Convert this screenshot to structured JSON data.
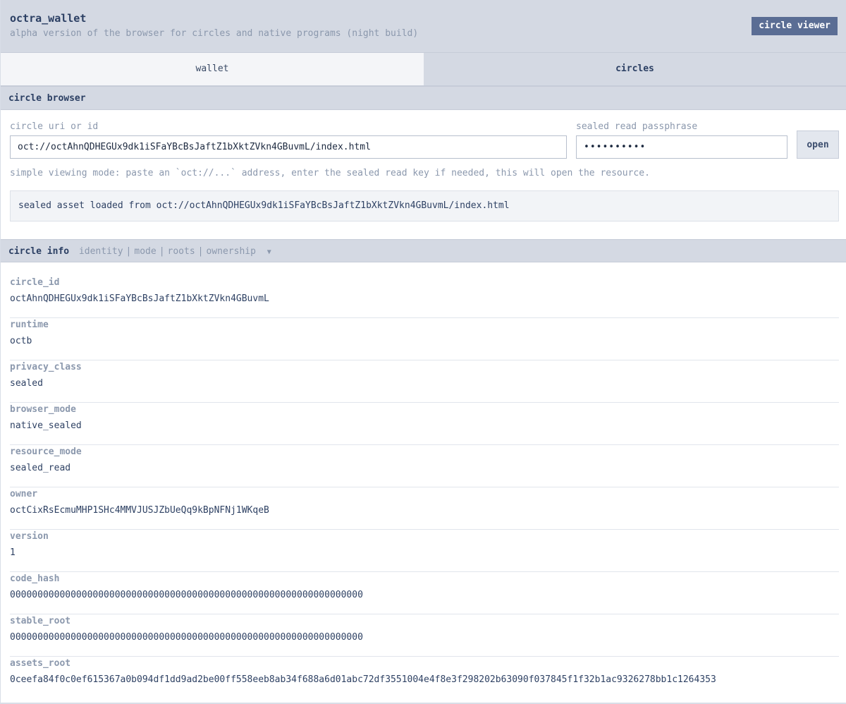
{
  "header": {
    "title": "octra_wallet",
    "subtitle": "alpha version of the browser for circles and native programs (night build)",
    "viewer_button": "circle viewer"
  },
  "tabs": {
    "wallet": "wallet",
    "circles": "circles",
    "active": "circles"
  },
  "browser": {
    "section_title": "circle browser",
    "uri_label": "circle uri or id",
    "uri_value": "oct://octAhnQDHEGUx9dk1iSFaYBcBsJaftZ1bXktZVkn4GBuvmL/index.html",
    "pass_label": "sealed read passphrase",
    "pass_value": "••••••••••",
    "open_button": "open",
    "hint": "simple viewing mode: paste an `oct://...` address, enter the sealed read key if needed, this will open the resource.",
    "status": "sealed asset loaded from oct://octAhnQDHEGUx9dk1iSFaYBcBsJaftZ1bXktZVkn4GBuvmL/index.html"
  },
  "info": {
    "title": "circle info",
    "links": [
      "identity",
      "mode",
      "roots",
      "ownership"
    ],
    "fields": [
      {
        "key": "circle_id",
        "value": "octAhnQDHEGUx9dk1iSFaYBcBsJaftZ1bXktZVkn4GBuvmL"
      },
      {
        "key": "runtime",
        "value": "octb"
      },
      {
        "key": "privacy_class",
        "value": "sealed"
      },
      {
        "key": "browser_mode",
        "value": "native_sealed"
      },
      {
        "key": "resource_mode",
        "value": "sealed_read"
      },
      {
        "key": "owner",
        "value": "octCixRsEcmuMHP1SHc4MMVJUSJZbUeQq9kBpNFNj1WKqeB"
      },
      {
        "key": "version",
        "value": "1"
      },
      {
        "key": "code_hash",
        "value": "0000000000000000000000000000000000000000000000000000000000000000"
      },
      {
        "key": "stable_root",
        "value": "0000000000000000000000000000000000000000000000000000000000000000"
      },
      {
        "key": "assets_root",
        "value": "0ceefa84f0c0ef615367a0b094df1dd9ad2be00ff558eeb8ab34f688a6d01abc72df3551004e4f8e3f298202b63090f037845f1f32b1ac9326278bb1c1264353"
      }
    ]
  }
}
